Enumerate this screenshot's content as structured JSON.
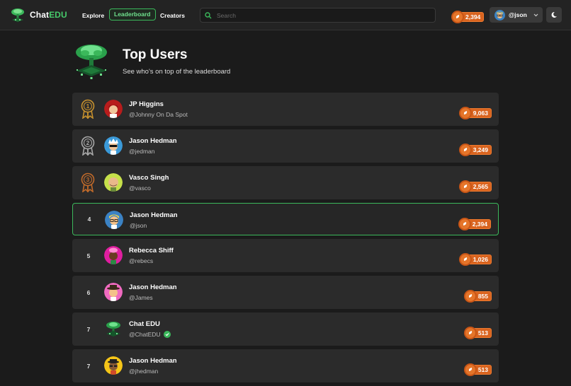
{
  "nav": {
    "brand_prefix": "Chat",
    "brand_suffix": "EDU",
    "links": [
      "Explore",
      "Leaderboard",
      "Creators"
    ],
    "active_link": "Leaderboard",
    "search_placeholder": "Search",
    "coins": "2,394",
    "user_handle": "@json"
  },
  "header": {
    "title": "Top Users",
    "subtitle": "See who's on top of the leaderboard"
  },
  "colors": {
    "accent_green": "#3bb85b",
    "coin_orange": "#d9641f",
    "gold": "#c8922e",
    "silver": "#a9a9a9",
    "bronze": "#c06a2a"
  },
  "rows": [
    {
      "rank": "1",
      "medal": "gold",
      "name": "JP Higgins",
      "handle": "@Johnny On Da Spot",
      "coins": "9,063",
      "avatar": "avatar-red-hair",
      "me": false
    },
    {
      "rank": "2",
      "medal": "silver",
      "name": "Jason Hedman",
      "handle": "@jedman",
      "coins": "3,249",
      "avatar": "avatar-sunglasses",
      "me": false
    },
    {
      "rank": "3",
      "medal": "bronze",
      "name": "Vasco Singh",
      "handle": "@vasco",
      "coins": "2,565",
      "avatar": "avatar-bald",
      "me": false
    },
    {
      "rank": "4",
      "medal": "",
      "name": "Jason Hedman",
      "handle": "@json",
      "coins": "2,394",
      "avatar": "avatar-glasses-blond",
      "me": true
    },
    {
      "rank": "5",
      "medal": "",
      "name": "Rebecca Shiff",
      "handle": "@rebecs",
      "coins": "1,026",
      "avatar": "avatar-pink-hair",
      "me": false
    },
    {
      "rank": "6",
      "medal": "",
      "name": "Jason Hedman",
      "handle": "@James",
      "coins": "855",
      "avatar": "avatar-hat",
      "me": false
    },
    {
      "rank": "7",
      "medal": "",
      "name": "Chat EDU",
      "handle": "@ChatEDU",
      "coins": "513",
      "avatar": "avatar-chatedu-logo",
      "me": false,
      "verified": true
    },
    {
      "rank": "7",
      "medal": "",
      "name": "Jason Hedman",
      "handle": "@jhedman",
      "coins": "513",
      "avatar": "avatar-yellow",
      "me": false
    }
  ]
}
